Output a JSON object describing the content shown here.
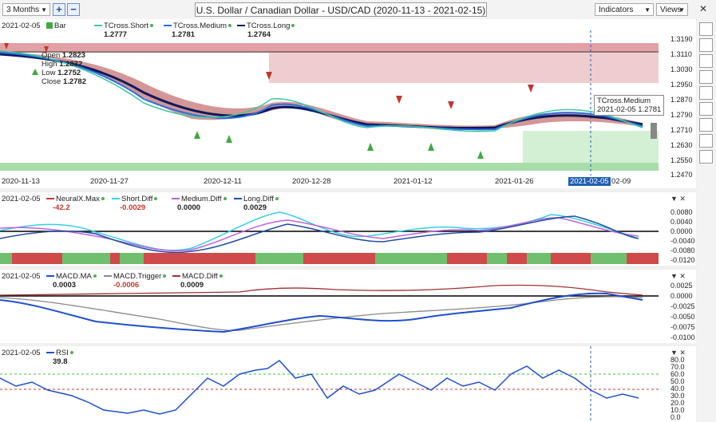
{
  "toolbar": {
    "period": "3 Months",
    "add_label": "+",
    "minus_label": "−",
    "title": "U.S. Dollar / Canadian Dollar - USD/CAD (2020-11-13 - 2021-02-15)",
    "indicators": "Indicators",
    "views": "Views"
  },
  "price_panel": {
    "date": "2021-02-05",
    "bar_label": "Bar",
    "ohlc": {
      "open_label": "Open",
      "open": "1.2823",
      "high_label": "High",
      "high": "1.2832",
      "low_label": "Low",
      "low": "1.2752",
      "close_label": "Close",
      "close": "1.2782"
    },
    "legend": [
      {
        "name": "TCross.Short",
        "value": "1.2777",
        "color": "#3cc8a0"
      },
      {
        "name": "TCross.Medium",
        "value": "1.2781",
        "color": "#2a6de0"
      },
      {
        "name": "TCross.Long",
        "value": "1.2764",
        "color": "#0a1a5c"
      }
    ],
    "y_ticks": [
      "1.3190",
      "1.3110",
      "1.3030",
      "1.2950",
      "1.2870",
      "1.2790",
      "1.2710",
      "1.2630",
      "1.2550",
      "1.2470"
    ],
    "x_ticks": [
      "2020-11-13",
      "2020-11-27",
      "2020-12-11",
      "2020-12-28",
      "2021-01-12",
      "2021-01-26",
      "2021-02-05",
      "02-09"
    ],
    "tooltip": {
      "title": "TCross.Medium",
      "date": "2021-02-05",
      "value": "1.2781"
    }
  },
  "neuralx_panel": {
    "date": "2021-02-05",
    "legend": [
      {
        "name": "NeuralX.Max",
        "value": "-42.2",
        "color": "#c0392b"
      },
      {
        "name": "Short.Diff",
        "value": "-0.0029",
        "color": "#35d0e0"
      },
      {
        "name": "Medium.Diff",
        "value": "0.0000",
        "color": "#c060e0"
      },
      {
        "name": "Long.Diff",
        "value": "0.0029",
        "color": "#1f4f9f"
      }
    ],
    "y_ticks": [
      "0.0080",
      "0.0040",
      "0.0000",
      "-0.0040",
      "-0.0080",
      "-0.0120"
    ]
  },
  "macd_panel": {
    "date": "2021-02-05",
    "legend": [
      {
        "name": "MACD.MA",
        "value": "0.0003",
        "color": "#1f4fd0"
      },
      {
        "name": "MACD.Trigger",
        "value": "-0.0006",
        "color": "#888888"
      },
      {
        "name": "MACD.Diff",
        "value": "0.0009",
        "color": "#a03030"
      }
    ],
    "y_ticks": [
      "0.0025",
      "0.0000",
      "-0.0025",
      "-0.0050",
      "-0.0075",
      "-0.0100"
    ]
  },
  "rsi_panel": {
    "date": "2021-02-05",
    "legend": [
      {
        "name": "RSI",
        "value": "39.8",
        "color": "#1f4fd0"
      }
    ],
    "y_ticks": [
      "80.0",
      "70.0",
      "60.0",
      "50.0",
      "40.0",
      "30.0",
      "20.0",
      "10.0",
      "0.0"
    ]
  },
  "colors": {
    "bull": "#3faa3f",
    "bear": "#c0392b",
    "resistance": "#d9898f",
    "support": "#9fd99f"
  }
}
